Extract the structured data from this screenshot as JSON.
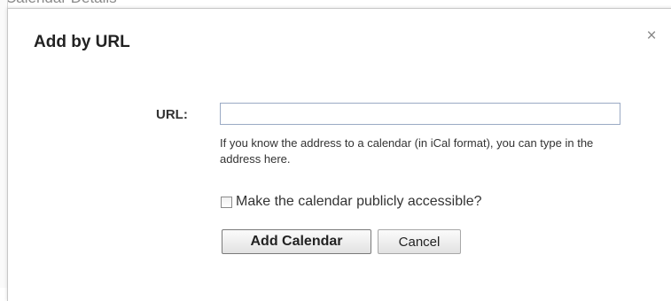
{
  "background": {
    "peek_text": "Calendar Details"
  },
  "dialog": {
    "title": "Add by URL",
    "close_glyph": "×",
    "close_icon": "close-icon",
    "url_label": "URL:",
    "url_value": "",
    "help_text": "If you know the address to a calendar (in iCal format), you can type in the address here.",
    "public_checkbox": {
      "label": "Make the calendar publicly accessible?",
      "checked": false
    },
    "add_button_label": "Add Calendar",
    "cancel_button_label": "Cancel"
  },
  "colors": {
    "input_border": "#9aaac4",
    "title_text": "#222222",
    "close_icon": "#888888"
  }
}
